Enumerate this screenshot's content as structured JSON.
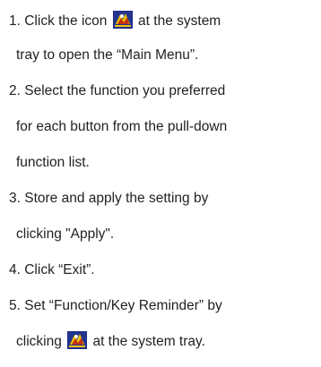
{
  "instructions": {
    "step1": {
      "prefix": "1. Click the icon",
      "suffix": "at the system",
      "cont": "tray to open the “Main Menu”."
    },
    "step2": {
      "line1": "2. Select the function you preferred",
      "line2": "for each button from the pull-down",
      "line3": "function list."
    },
    "step3": {
      "line1": "3. Store and apply the setting by",
      "line2": "clicking \"Apply\"."
    },
    "step4": {
      "line1": "4. Click “Exit”."
    },
    "step5": {
      "line1": "5. Set “Function/Key Reminder” by",
      "prefix": "clicking",
      "suffix": "at the system tray."
    }
  },
  "icons": {
    "tray_icon": "system-tray-app-icon",
    "tray_icon_colors": [
      "#1a2a8a",
      "#f2c200",
      "#c03010",
      "#ffffff"
    ]
  }
}
